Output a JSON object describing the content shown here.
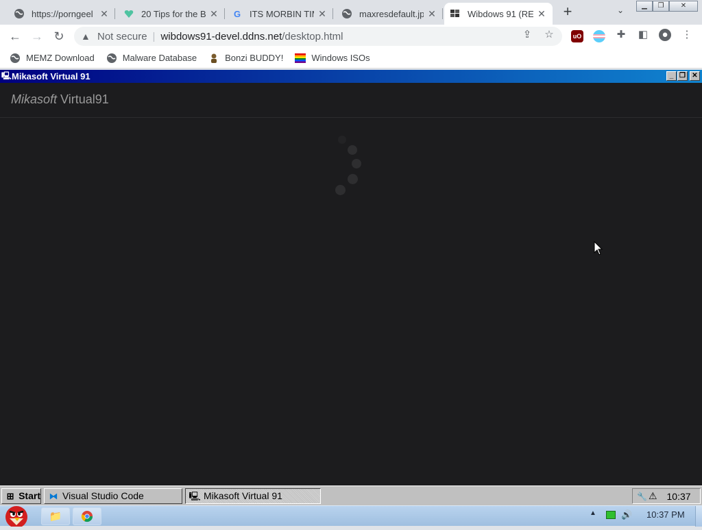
{
  "browser": {
    "tabs": [
      {
        "title": "https://porngeel",
        "favicon": "globe-icon"
      },
      {
        "title": "20 Tips for the B",
        "favicon": "heart-icon"
      },
      {
        "title": "ITS MORBIN TIM",
        "favicon": "google-icon"
      },
      {
        "title": "maxresdefault.jp",
        "favicon": "globe-icon"
      },
      {
        "title": "Wibdows 91 (RE",
        "favicon": "windows-flag-icon"
      }
    ],
    "address": {
      "security": "Not secure",
      "host": "wibdows91-devel.ddns.net",
      "path": "/desktop.html"
    },
    "bookmarks": [
      {
        "label": "MEMZ Download",
        "icon": "globe-icon"
      },
      {
        "label": "Malware Database",
        "icon": "globe-icon"
      },
      {
        "label": "Bonzi BUDDY!",
        "icon": "bonzi-icon"
      },
      {
        "label": "Windows ISOs",
        "icon": "rainbow-flag-icon"
      }
    ]
  },
  "window": {
    "title": "Mikasoft Virtual 91",
    "brand_italic": "Mikasoft",
    "brand_rest": " Virtual91"
  },
  "taskbar": {
    "start_label": "Start",
    "items": [
      {
        "label": "Visual Studio Code",
        "icon": "vscode-icon",
        "active": false
      },
      {
        "label": "Mikasoft Virtual 91",
        "icon": "computer-icon",
        "active": true
      }
    ],
    "clock": "10:37"
  },
  "os_taskbar": {
    "time": "10:37 PM"
  },
  "colors": {
    "page_bg": "#1c1c1e",
    "title_gradient_start": "#000080",
    "title_gradient_end": "#1084d0",
    "win95_gray": "#c0c0c0"
  }
}
